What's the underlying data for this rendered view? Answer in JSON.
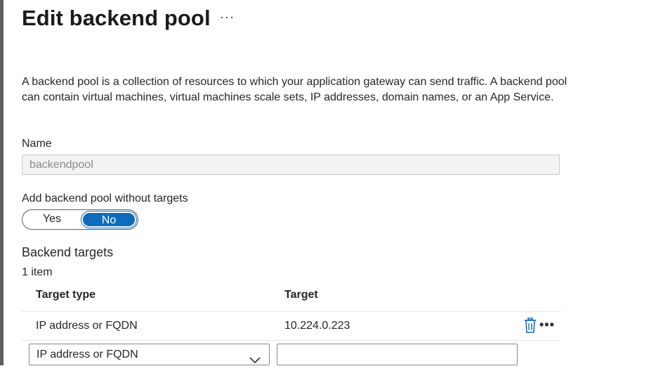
{
  "header": {
    "title": "Edit backend pool",
    "more_label": "···"
  },
  "description": "A backend pool is a collection of resources to which your application gateway can send traffic. A backend pool can contain virtual machines, virtual machines scale sets, IP addresses, domain names, or an App Service.",
  "name_field": {
    "label": "Name",
    "value": "backendpool"
  },
  "without_targets": {
    "label": "Add backend pool without targets",
    "options": [
      "Yes",
      "No"
    ],
    "selected": "No"
  },
  "backend_targets": {
    "title": "Backend targets",
    "count": "1 item",
    "columns": [
      "Target type",
      "Target"
    ],
    "rows": [
      {
        "type": "IP address or FQDN",
        "target": "10.224.0.223"
      }
    ],
    "new_row": {
      "type": "IP address or FQDN",
      "target": ""
    },
    "row_more_label": "•••"
  },
  "colors": {
    "accent": "#0f6cbd"
  },
  "icons": {
    "delete": "trash-icon",
    "more": "more-icon",
    "dropdown": "chevron-down-icon"
  }
}
